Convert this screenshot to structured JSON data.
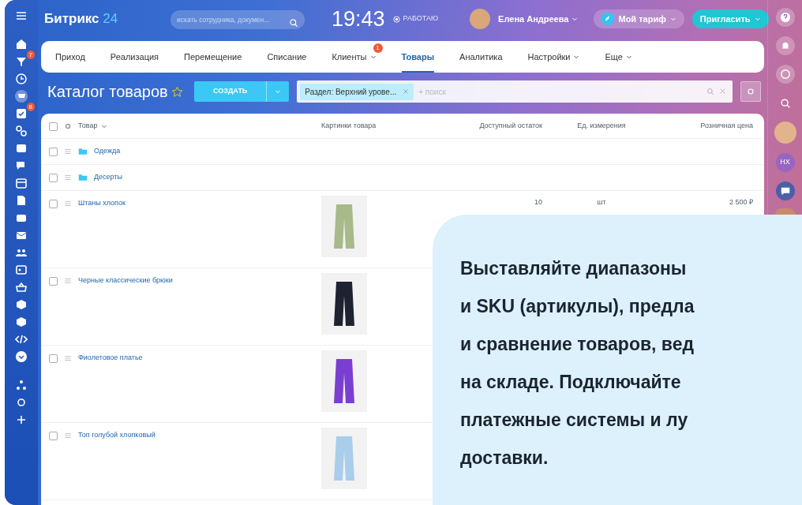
{
  "left_sidebar": {
    "badges": [
      "7",
      "8"
    ]
  },
  "topbar": {
    "logo": {
      "text": "Битрикс",
      "number": "24"
    },
    "search": {
      "placeholder": "искать сотрудника, докумен..."
    },
    "time": "19:43",
    "work_status": "РАБОТАЮ",
    "user": "Елена Андреева",
    "tariff_button": "Мой тариф",
    "invite_button": "Пригласить"
  },
  "tabs": [
    {
      "label": "Приход",
      "selected": false,
      "dropdown": false
    },
    {
      "label": "Реализация",
      "selected": false,
      "dropdown": false
    },
    {
      "label": "Перемещение",
      "selected": false,
      "dropdown": false
    },
    {
      "label": "Списание",
      "selected": false,
      "dropdown": false
    },
    {
      "label": "Клиенты",
      "selected": false,
      "dropdown": true,
      "badge": "1"
    },
    {
      "label": "Товары",
      "selected": true,
      "dropdown": false
    },
    {
      "label": "Аналитика",
      "selected": false,
      "dropdown": false
    },
    {
      "label": "Настройки",
      "selected": false,
      "dropdown": true
    },
    {
      "label": "Еще",
      "selected": false,
      "dropdown": true
    }
  ],
  "catalog": {
    "title": "Каталог товаров",
    "favorite": false,
    "create_button": "СОЗДАТЬ",
    "filter": {
      "chip": "Раздел: Верхний урове...",
      "placeholder": "+ поиск"
    }
  },
  "table": {
    "columns": [
      "Товар",
      "Картинки товара",
      "Доступный остаток",
      "Ед. измерения",
      "Розничная цена"
    ],
    "header_checked": false,
    "rows": [
      {
        "kind": "folder",
        "name": "Одежда",
        "checked": false
      },
      {
        "kind": "folder",
        "name": "Десерты",
        "checked": false
      },
      {
        "kind": "product",
        "name": "Штаны хлопок",
        "checked": false,
        "color": "#a8b98a",
        "stock": "10",
        "unit": "шт",
        "price": "2 500 ₽"
      },
      {
        "kind": "product",
        "name": "Черные классические брюки",
        "checked": false,
        "color": "#1d2330"
      },
      {
        "kind": "product",
        "name": "Фиолетовое платье",
        "checked": false,
        "color": "#7a3fd0"
      },
      {
        "kind": "product",
        "name": "Топ голубой хлопковый",
        "checked": false,
        "color": "#a9cdea"
      }
    ]
  },
  "right_panel": {
    "initials": "НХ"
  },
  "callout": {
    "lines": [
      "Выставляйте диапазоны",
      "и SKU (артикулы), предла",
      "и сравнение товаров, вед",
      "на складе. Подключайте",
      "платежные системы и лу",
      "доставки."
    ]
  }
}
